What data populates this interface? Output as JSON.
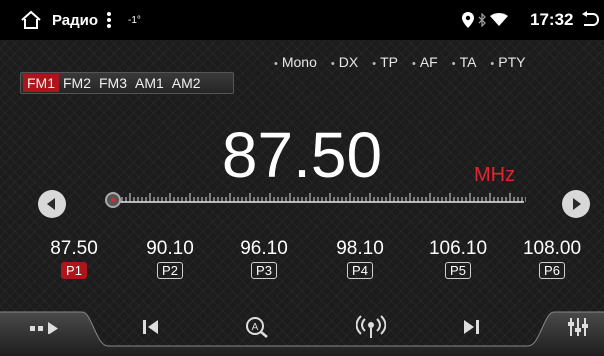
{
  "status_bar": {
    "app_title": "Радио",
    "temperature": "-1°",
    "time": "17:32",
    "icons": [
      "home-icon",
      "menu-dots-icon",
      "location-icon",
      "bluetooth-icon",
      "wifi-icon",
      "back-icon"
    ]
  },
  "rds_flags": [
    "Mono",
    "DX",
    "TP",
    "AF",
    "TA",
    "PTY"
  ],
  "bands": [
    "FM1",
    "FM2",
    "FM3",
    "AM1",
    "AM2"
  ],
  "active_band": "FM1",
  "frequency": {
    "value": "87.50",
    "unit": "MHz"
  },
  "presets": [
    {
      "freq": "87.50",
      "label": "P1",
      "active": true
    },
    {
      "freq": "90.10",
      "label": "P2",
      "active": false
    },
    {
      "freq": "96.10",
      "label": "P3",
      "active": false
    },
    {
      "freq": "98.10",
      "label": "P4",
      "active": false
    },
    {
      "freq": "106.10",
      "label": "P5",
      "active": false
    },
    {
      "freq": "108.00",
      "label": "P6",
      "active": false
    }
  ],
  "bottom_bar": {
    "icons": [
      "sources-icon",
      "previous-icon",
      "auto-search-icon",
      "radio-broadcast-icon",
      "next-icon",
      "equalizer-icon"
    ]
  },
  "colors": {
    "accent": "#b0141b",
    "unit_red": "#e0262e",
    "background": "#1c1c1c"
  }
}
